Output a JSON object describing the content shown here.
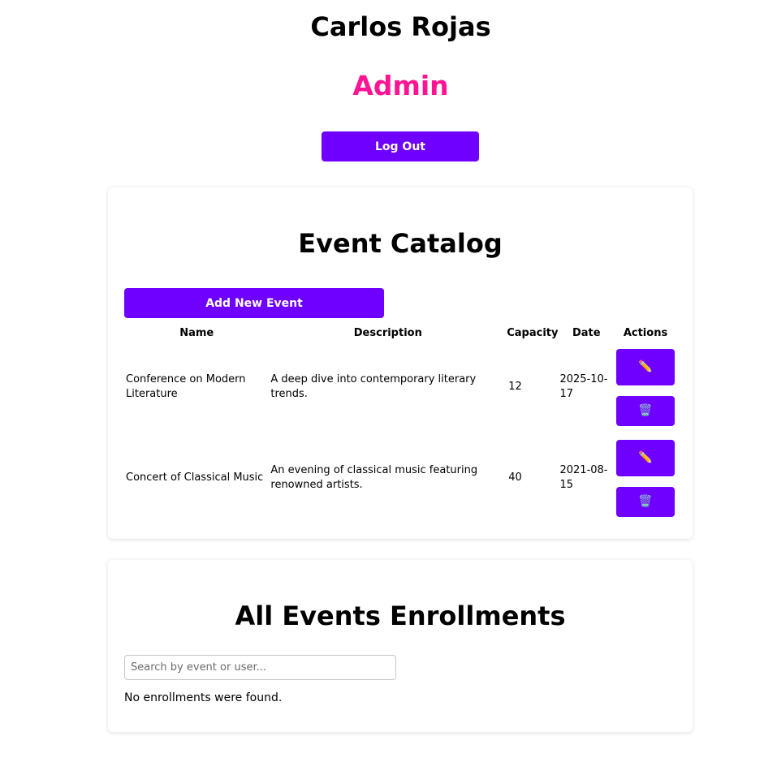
{
  "header": {
    "user_name": "Carlos Rojas",
    "role": "Admin",
    "logout_label": "Log Out"
  },
  "catalog": {
    "title": "Event Catalog",
    "add_label": "Add New Event",
    "columns": [
      "Name",
      "Description",
      "Capacity",
      "Date",
      "Actions"
    ],
    "rows": [
      {
        "name": "Conference on Modern Literature",
        "description": "A deep dive into contemporary literary trends.",
        "capacity": "12",
        "date": "2025-10-17"
      },
      {
        "name": "Concert of Classical Music",
        "description": "An evening of classical music featuring renowned artists.",
        "capacity": "40",
        "date": "2021-08-15"
      }
    ],
    "edit_icon": "✏️",
    "delete_icon": "🗑️"
  },
  "enrollments": {
    "title": "All Events Enrollments",
    "search_placeholder": "Search by event or user...",
    "search_value": "",
    "empty_text": "No enrollments were found."
  },
  "colors": {
    "accent": "#6f00ff",
    "role": "#ff1493"
  }
}
